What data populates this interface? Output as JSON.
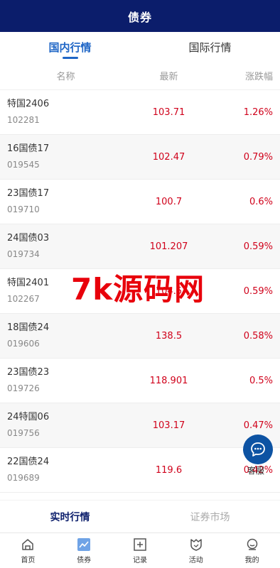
{
  "header": {
    "title": "债券"
  },
  "tabs": [
    {
      "label": "国内行情",
      "active": true
    },
    {
      "label": "国际行情",
      "active": false
    }
  ],
  "columns": {
    "name": "名称",
    "latest": "最新",
    "change": "涨跌幅"
  },
  "rows": [
    {
      "name": "特国2406",
      "code": "102281",
      "price": "103.71",
      "change": "1.26%"
    },
    {
      "name": "16国债17",
      "code": "019545",
      "price": "102.47",
      "change": "0.79%"
    },
    {
      "name": "23国债17",
      "code": "019710",
      "price": "100.7",
      "change": "0.6%"
    },
    {
      "name": "24国债03",
      "code": "019734",
      "price": "101.207",
      "change": "0.59%"
    },
    {
      "name": "特国2401",
      "code": "102267",
      "price": "104.5",
      "change": "0.59%"
    },
    {
      "name": "18国债24",
      "code": "019606",
      "price": "138.5",
      "change": "0.58%"
    },
    {
      "name": "23国债23",
      "code": "019726",
      "price": "118.901",
      "change": "0.5%"
    },
    {
      "name": "24特国06",
      "code": "019756",
      "price": "103.17",
      "change": "0.47%"
    },
    {
      "name": "22国债24",
      "code": "019689",
      "price": "119.6",
      "change": "0.42%"
    }
  ],
  "watermark": "7k源码网",
  "service": {
    "label": "客服"
  },
  "subtabs": [
    {
      "label": "实时行情",
      "active": true
    },
    {
      "label": "证券市场",
      "active": false
    }
  ],
  "bottom_nav": [
    {
      "label": "首页",
      "icon": "home-icon"
    },
    {
      "label": "债券",
      "icon": "chart-icon",
      "active": true
    },
    {
      "label": "记录",
      "icon": "plus-box-icon"
    },
    {
      "label": "活动",
      "icon": "badge-icon"
    },
    {
      "label": "我的",
      "icon": "user-icon"
    }
  ],
  "colors": {
    "header_bg": "#0b1d6b",
    "accent": "#1f66c6",
    "up": "#d0021b"
  }
}
